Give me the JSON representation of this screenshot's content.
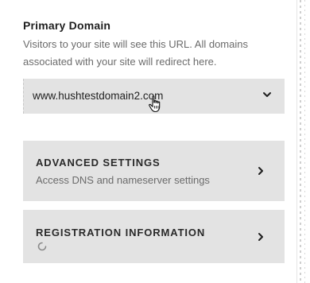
{
  "primary_domain": {
    "title": "Primary Domain",
    "description": "Visitors to your site will see this URL. All domains associated with your site will redirect here.",
    "selected_value": "www.hushtestdomain2.com"
  },
  "cards": {
    "advanced": {
      "title": "ADVANCED SETTINGS",
      "subtitle": "Access DNS and nameserver settings"
    },
    "registration": {
      "title": "REGISTRATION INFORMATION"
    }
  },
  "icons": {
    "dropdown": "chevron-down-icon",
    "card_arrow": "chevron-right-icon",
    "loading": "spinner-icon",
    "pointer": "hand-cursor-icon"
  },
  "colors": {
    "card_bg": "#e3e3e3",
    "text": "#1f1f1f",
    "muted_text": "#6b6b6b"
  }
}
